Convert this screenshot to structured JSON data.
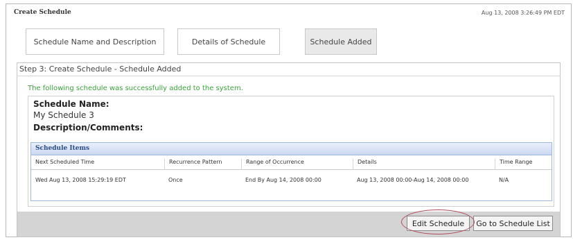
{
  "page": {
    "title": "Create Schedule",
    "timestamp": "Aug 13, 2008 3:26:49 PM EDT"
  },
  "tabs": [
    {
      "label": "Schedule Name and Description"
    },
    {
      "label": "Details of Schedule"
    },
    {
      "label": "Schedule Added"
    }
  ],
  "step": {
    "header": "Step 3: Create Schedule - Schedule Added",
    "success_message": "The following schedule was successfully added to the system.",
    "name_label": "Schedule Name:",
    "name_value": "My Schedule 3",
    "description_label": "Description/Comments:"
  },
  "schedule_items": {
    "title": "Schedule Items",
    "columns": [
      "Next Scheduled Time",
      "Recurrence Pattern",
      "Range of Occurrence",
      "Details",
      "Time Range"
    ],
    "rows": [
      [
        "Wed Aug 13, 2008 15:29:19 EDT",
        "Once",
        "End By Aug 14, 2008 00:00",
        "Aug 13, 2008 00:00-Aug 14, 2008 00:00",
        "N/A"
      ]
    ]
  },
  "actions": {
    "edit_label": "Edit Schedule",
    "goto_label": "Go to Schedule List"
  },
  "colors": {
    "success": "#3aa33a",
    "table_header": "#cdd9f1",
    "highlight_oval": "#b04a5a"
  }
}
